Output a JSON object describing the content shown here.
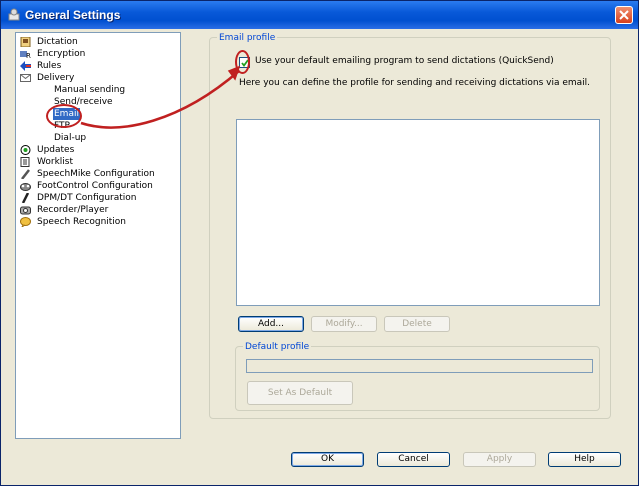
{
  "window": {
    "title": "General Settings"
  },
  "tree": {
    "items": [
      {
        "label": "Dictation",
        "icon": "dictation-icon"
      },
      {
        "label": "Encryption",
        "icon": "encryption-icon"
      },
      {
        "label": "Rules",
        "icon": "rules-icon"
      },
      {
        "label": "Delivery",
        "icon": "delivery-icon"
      },
      {
        "label": "Updates",
        "icon": "updates-icon"
      },
      {
        "label": "Worklist",
        "icon": "worklist-icon"
      },
      {
        "label": "SpeechMike Configuration",
        "icon": "speechmike-icon"
      },
      {
        "label": "FootControl Configuration",
        "icon": "footcontrol-icon"
      },
      {
        "label": "DPM/DT Configuration",
        "icon": "dpm-icon"
      },
      {
        "label": "Recorder/Player",
        "icon": "recorder-icon"
      },
      {
        "label": "Speech Recognition",
        "icon": "speech-recognition-icon"
      }
    ],
    "delivery_children": [
      {
        "label": "Manual sending"
      },
      {
        "label": "Send/receive"
      },
      {
        "label": "Email",
        "selected": true
      },
      {
        "label": "FTP"
      },
      {
        "label": "Dial-up"
      }
    ]
  },
  "email_profile": {
    "group_title": "Email profile",
    "checkbox_label": "Use your default emailing program to send dictations (QuickSend)",
    "checkbox_checked": true,
    "description": "Here you can define the profile for sending and receiving dictations via email.",
    "buttons": {
      "add": "Add...",
      "modify": "Modify...",
      "delete": "Delete"
    },
    "default_profile": {
      "group_title": "Default profile",
      "value": "",
      "set_default_label": "Set As Default"
    }
  },
  "footer": {
    "ok": "OK",
    "cancel": "Cancel",
    "apply": "Apply",
    "help": "Help"
  },
  "colors": {
    "titlebar": "#0859d8",
    "selection": "#316ac5",
    "annotation": "#c02020",
    "groupTitle": "#0046d5"
  }
}
